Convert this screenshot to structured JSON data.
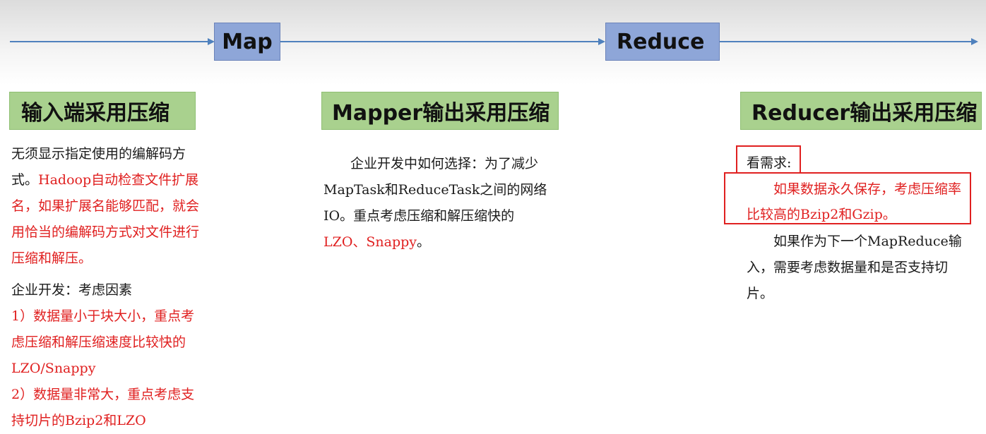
{
  "flow": {
    "map_label": "Map",
    "reduce_label": "Reduce",
    "line_color": "#4f81bd",
    "stage_color": "#8ea6d8"
  },
  "left": {
    "title": "输入端采用压缩",
    "intro_black": "无须显示指定使用的编解码方式。",
    "intro_red": "Hadoop自动检查文件扩展名，如果扩展名能够匹配，就会用恰当的编解码方式对文件进行压缩和解压。",
    "factors_heading": "企业开发：考虑因素",
    "factor1": "1）数据量小于块大小，重点考虑压缩和解压缩速度比较快的LZO/Snappy",
    "factor2": "2）数据量非常大，重点考虑支持切片的Bzip2和LZO"
  },
  "middle": {
    "title": "Mapper输出采用压缩",
    "body_black": "企业开发中如何选择：为了减少MapTask和ReduceTask之间的网络IO。重点考虑压缩和解压缩快的",
    "body_red": "LZO、Snappy",
    "body_end": "。"
  },
  "right": {
    "title": "Reducer输出采用压缩",
    "label": "看需求:",
    "highlight": "如果数据永久保存，考虑压缩率比较高的Bzip2和Gzip。",
    "body": "如果作为下一个MapReduce输入，需要考虑数据量和是否支持切片。"
  },
  "colors": {
    "title_bg": "#a9d18e",
    "emphasis": "#e02020"
  }
}
